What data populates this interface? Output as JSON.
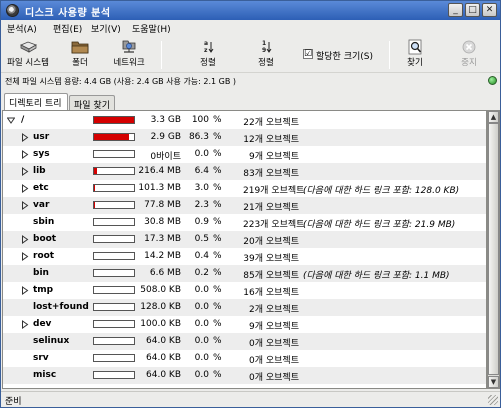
{
  "window": {
    "title": "디스크 사용량 분석",
    "buttons": {
      "minimize": "_",
      "maximize": "□",
      "close": "✕"
    }
  },
  "menubar": {
    "items": [
      {
        "label": "분석(A)"
      },
      {
        "label": "편집(E)"
      },
      {
        "label": "보기(V)"
      },
      {
        "label": "도움말(H)"
      }
    ]
  },
  "toolbar": {
    "filesystem_label": "파일 시스템",
    "folder_label": "폴더",
    "network_label": "네트워크",
    "sort_alpha_label": "정렬",
    "sort_num_label": "정렬",
    "allocated_size_label": "할당한 크기(S)",
    "allocated_size_checked": "☑",
    "find_label": "찾기",
    "stop_label": "중지"
  },
  "info": {
    "text": "전체 파일 시스템 용량: 4.4 GB (사용: 2.4 GB 사용 가능: 2.1 GB )"
  },
  "tabs": {
    "tree": "디렉토리 트리",
    "files": "파일 찾기"
  },
  "colors": {
    "usage_bar_fill": "#d40000",
    "titlebar": "#3a6ec8",
    "status_dot": "#2aa02a"
  },
  "rows": [
    {
      "name": "/",
      "expander": "open",
      "usage": 1.0,
      "size": "3.3 GB",
      "percent": "100",
      "count": "22개 오브젝트",
      "note": ""
    },
    {
      "name": "usr",
      "expander": "closed",
      "usage": 0.863,
      "size": "2.9 GB",
      "percent": "86.3",
      "count": "12개 오브젝트",
      "note": ""
    },
    {
      "name": "sys",
      "expander": "closed",
      "usage": 0.0,
      "size": "0바이트",
      "percent": "0.0",
      "count": "9개 오브젝트",
      "note": ""
    },
    {
      "name": "lib",
      "expander": "closed",
      "usage": 0.064,
      "size": "216.4 MB",
      "percent": "6.4",
      "count": "83개 오브젝트",
      "note": ""
    },
    {
      "name": "etc",
      "expander": "closed",
      "usage": 0.03,
      "size": "101.3 MB",
      "percent": "3.0",
      "count": "219개 오브젝트",
      "note": "(다음에 대한 하드 링크 포함: 128.0 KB)"
    },
    {
      "name": "var",
      "expander": "closed",
      "usage": 0.023,
      "size": "77.8 MB",
      "percent": "2.3",
      "count": "21개 오브젝트",
      "note": ""
    },
    {
      "name": "sbin",
      "expander": "none",
      "usage": 0.009,
      "size": "30.8 MB",
      "percent": "0.9",
      "count": "223개 오브젝트",
      "note": "(다음에 대한 하드 링크 포함: 21.9 MB)"
    },
    {
      "name": "boot",
      "expander": "closed",
      "usage": 0.005,
      "size": "17.3 MB",
      "percent": "0.5",
      "count": "20개 오브젝트",
      "note": ""
    },
    {
      "name": "root",
      "expander": "closed",
      "usage": 0.004,
      "size": "14.2 MB",
      "percent": "0.4",
      "count": "39개 오브젝트",
      "note": ""
    },
    {
      "name": "bin",
      "expander": "none",
      "usage": 0.002,
      "size": "6.6 MB",
      "percent": "0.2",
      "count": "85개 오브젝트",
      "note": "(다음에 대한 하드 링크 포함: 1.1 MB)"
    },
    {
      "name": "tmp",
      "expander": "closed",
      "usage": 0.0,
      "size": "508.0 KB",
      "percent": "0.0",
      "count": "16개 오브젝트",
      "note": ""
    },
    {
      "name": "lost+found",
      "expander": "none",
      "usage": 0.0,
      "size": "128.0 KB",
      "percent": "0.0",
      "count": "2개 오브젝트",
      "note": ""
    },
    {
      "name": "dev",
      "expander": "closed",
      "usage": 0.0,
      "size": "100.0 KB",
      "percent": "0.0",
      "count": "9개 오브젝트",
      "note": ""
    },
    {
      "name": "selinux",
      "expander": "none",
      "usage": 0.0,
      "size": "64.0 KB",
      "percent": "0.0",
      "count": "0개 오브젝트",
      "note": ""
    },
    {
      "name": "srv",
      "expander": "none",
      "usage": 0.0,
      "size": "64.0 KB",
      "percent": "0.0",
      "count": "0개 오브젝트",
      "note": ""
    },
    {
      "name": "misc",
      "expander": "none",
      "usage": 0.0,
      "size": "64.0 KB",
      "percent": "0.0",
      "count": "0개 오브젝트",
      "note": ""
    }
  ],
  "percent_symbol": "%",
  "status": {
    "text": "준비"
  }
}
